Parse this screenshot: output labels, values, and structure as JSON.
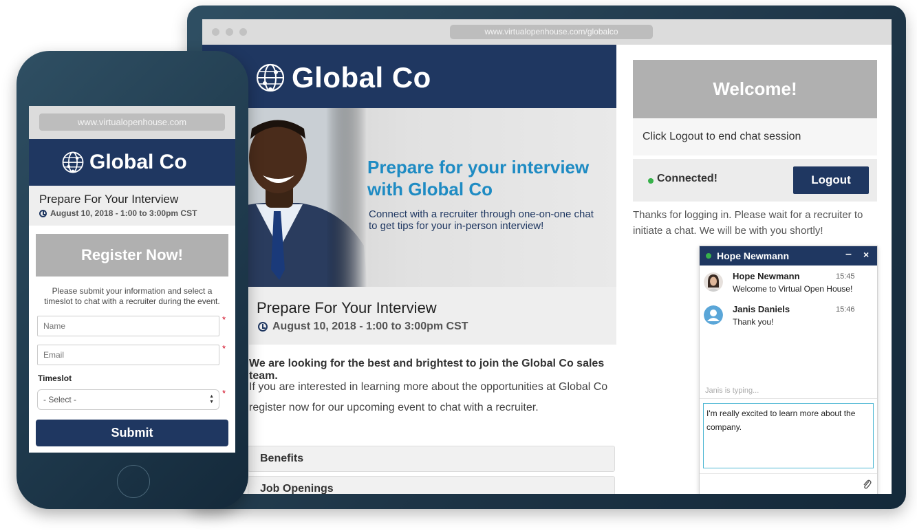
{
  "desktop": {
    "url": "www.virtualopenhouse.com/globalco",
    "brand_name": "Global Co",
    "hero": {
      "headline": "Prepare for your interview with Global Co",
      "subtext": "Connect with a recruiter through one-on-one chat to get tips for your in-person interview!"
    },
    "event": {
      "title": "Prepare For Your Interview",
      "date": "August 10, 2018 - 1:00 to 3:00pm CST"
    },
    "intro_bold": "We are looking for the best and brightest to join the Global Co sales team.",
    "intro_body": "If you are interested in learning more about the opportunities at Global Co register now for our upcoming event to chat with a recruiter.",
    "accordion": [
      "Benefits",
      "Job Openings"
    ],
    "sidebar": {
      "welcome": "Welcome!",
      "logout_hint": "Click Logout to end chat session",
      "status": "Connected!",
      "logout_label": "Logout",
      "thanks": "Thanks for logging in. Please wait for a recruiter to initiate a chat. We will be with you shortly!"
    },
    "chat": {
      "recruiter_name": "Hope Newmann",
      "minimize": "–",
      "close": "×",
      "messages": [
        {
          "author": "Hope Newmann",
          "time": "15:45",
          "text": "Welcome to Virtual Open House!"
        },
        {
          "author": "Janis Daniels",
          "time": "15:46",
          "text": "Thank you!"
        }
      ],
      "typing": "Janis is typing...",
      "input_value": "I'm really excited to learn more about the company."
    }
  },
  "phone": {
    "url": "www.virtualopenhouse.com",
    "brand_name": "Global Co",
    "event": {
      "title": "Prepare For Your Interview",
      "date": "August 10, 2018 - 1:00 to 3:00pm CST"
    },
    "register_label": "Register Now!",
    "instructions": "Please submit your information and select a timeslot to chat with a recruiter during the event.",
    "name_placeholder": "Name",
    "email_placeholder": "Email",
    "required_mark": "*",
    "timeslot_label": "Timeslot",
    "timeslot_value": "- Select -",
    "submit_label": "Submit"
  },
  "colors": {
    "brand_navy": "#1f3761",
    "hero_blue": "#1e8bc3",
    "status_green": "#37b14a",
    "required_red": "#d0021b",
    "frame_teal": "#1d3446"
  },
  "icons": [
    "globe-logo-icon",
    "clock-icon",
    "status-dot-icon",
    "minimize-icon",
    "close-icon",
    "avatar-icon",
    "paperclip-icon",
    "select-arrows-icon"
  ]
}
